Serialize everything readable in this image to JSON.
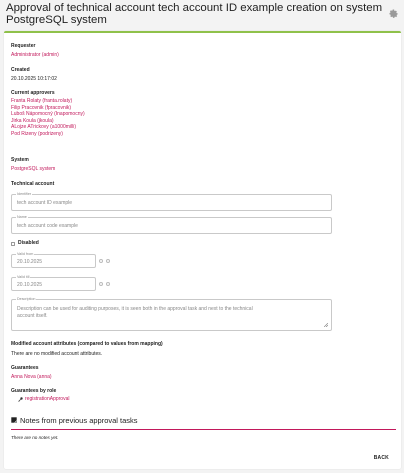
{
  "header": {
    "title_line1": "Approval of technical account tech account ID example creation on system",
    "title_line2": "PostgreSQL system",
    "settings_icon": "gear-icon"
  },
  "requester": {
    "label": "Requester",
    "value": "Administrator (admin)"
  },
  "created": {
    "label": "Created",
    "value": "20.10.2025 10:17:02"
  },
  "approvers": {
    "label": "Current approvers",
    "items": [
      "Franta Rolaty (franta.rolaty)",
      "Filip Pracovnik (fpracovnik)",
      "Luboš Nápomocný (Inapomocny)",
      "Jirka Koula (jkoula)",
      "ALojze ATrickovy (a1000milli)",
      "Pod Rizeny (podrizeny)"
    ]
  },
  "system": {
    "label": "System",
    "value": "PostgreSQL system"
  },
  "technical_account": {
    "label": "Technical account",
    "identifier_label": "Identifier",
    "identifier_value": "tech account ID example",
    "name_label": "Name",
    "name_value": "tech account code example",
    "disabled_label": "Disabled",
    "valid_from_label": "Valid from",
    "valid_from_value": "20.10.2025",
    "valid_till_label": "Valid till",
    "valid_till_value": "20.10.2025",
    "description_label": "Description",
    "description_line1": "Description can be used for auditing purposes, it is seen both in the approval task and next to the technical",
    "description_line2": "account itself."
  },
  "modified": {
    "label": "Modified account attributes (compared to values from mapping)",
    "value": "There are no modified account attributes."
  },
  "guarantees": {
    "label": "Guarantees",
    "value": "Anna Nova (anna)"
  },
  "guarantees_by_role": {
    "label": "Guarantees by role",
    "role": "registrationApproval"
  },
  "notes": {
    "title": "Notes from previous approval tasks",
    "empty": "There are no notes yet."
  },
  "actions": {
    "back": "BACK"
  },
  "colors": {
    "accent": "#c2185b",
    "top_border": "#8fc14a"
  }
}
